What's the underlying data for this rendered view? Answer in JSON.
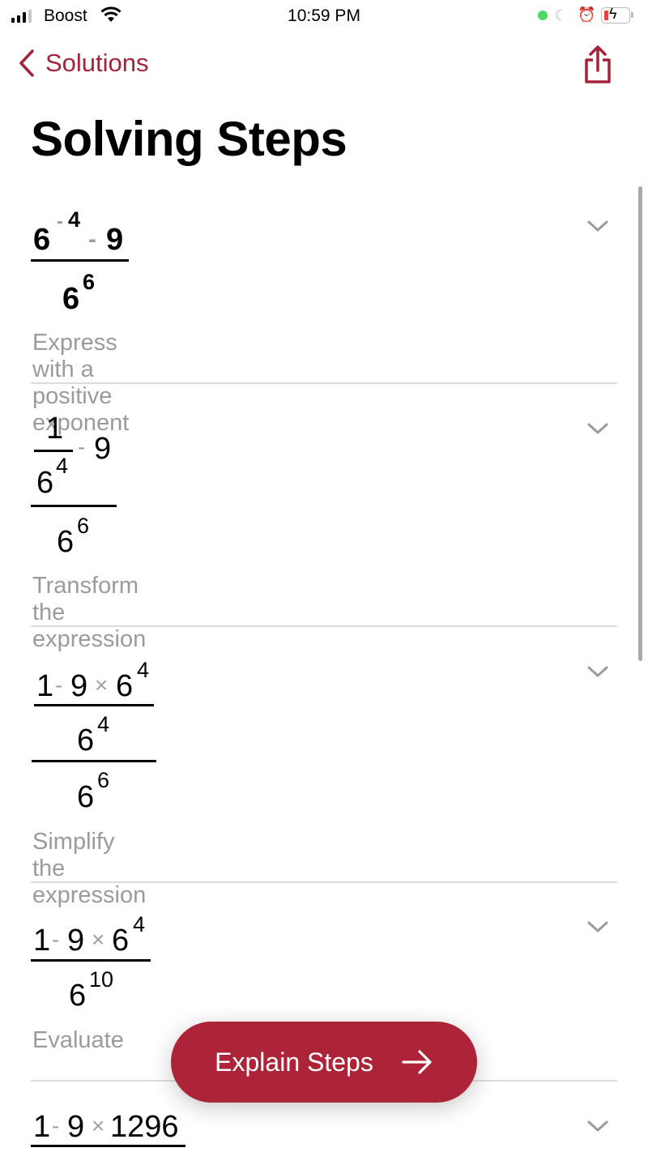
{
  "status_bar": {
    "carrier": "Boost",
    "time": "10:59 PM",
    "icons": [
      "signal-icon",
      "wifi-icon",
      "recording-dot-icon",
      "moon-icon",
      "alarm-icon",
      "battery-charging-icon"
    ],
    "battery_color": "#e8433b"
  },
  "nav": {
    "back_label": "Solutions",
    "back_icon": "chevron-left-icon",
    "share_icon": "share-icon",
    "accent_color": "#a3243a"
  },
  "page": {
    "title": "Solving Steps"
  },
  "steps": [
    {
      "expression": "(6^(-4) - 9) / 6^6",
      "parts": {
        "base": "6",
        "exp": "-4",
        "minus": "-",
        "nine": "9",
        "den_base": "6",
        "den_exp": "6"
      },
      "caption": "Express with a positive exponent"
    },
    {
      "expression": "(1/6^4 - 9) / 6^6",
      "parts": {
        "one": "1",
        "inner_den_base": "6",
        "inner_den_exp": "4",
        "minus": "-",
        "nine": "9",
        "den_base": "6",
        "den_exp": "6"
      },
      "caption": "Transform the expression"
    },
    {
      "expression": "((1 - 9×6^4) / 6^4) / 6^6",
      "parts": {
        "one": "1",
        "minus": "-",
        "nine": "9",
        "times": "×",
        "six": "6",
        "exp4": "4",
        "mid_base": "6",
        "mid_exp": "4",
        "den_base": "6",
        "den_exp": "6"
      },
      "caption": "Simplify the expression"
    },
    {
      "expression": "(1 - 9×6^4) / 6^10",
      "parts": {
        "one": "1",
        "minus": "-",
        "nine": "9",
        "times": "×",
        "six": "6",
        "exp4": "4",
        "den_base": "6",
        "den_exp": "10"
      },
      "caption": "Evaluate"
    },
    {
      "expression": "1 - 9×1296 ...",
      "parts": {
        "one": "1",
        "minus": "-",
        "nine": "9",
        "times": "×",
        "value": "1296"
      },
      "caption": ""
    }
  ],
  "explain_button": {
    "label": "Explain Steps",
    "icon": "arrow-right-icon",
    "color": "#ad2337"
  }
}
